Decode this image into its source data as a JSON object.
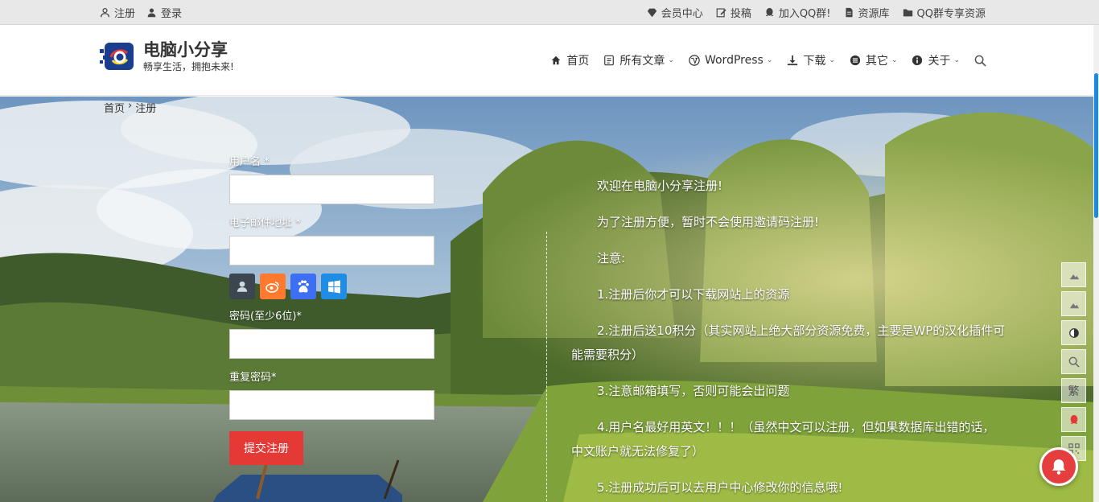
{
  "topbar": {
    "register": "注册",
    "login": "登录",
    "right_links": [
      {
        "label": "会员中心",
        "icon": "diamond-icon"
      },
      {
        "label": "投稿",
        "icon": "edit-icon"
      },
      {
        "label": "加入QQ群!",
        "icon": "qq-icon"
      },
      {
        "label": "资源库",
        "icon": "document-icon"
      },
      {
        "label": "QQ群专享资源",
        "icon": "folder-icon"
      }
    ]
  },
  "header": {
    "brand": "电脑小分享",
    "slogan": "畅享生活，拥抱未来!",
    "nav": [
      {
        "label": "首页",
        "icon": "home-icon",
        "dropdown": false
      },
      {
        "label": "所有文章",
        "icon": "article-icon",
        "dropdown": true
      },
      {
        "label": "WordPress",
        "icon": "wordpress-icon",
        "dropdown": true
      },
      {
        "label": "下载",
        "icon": "download-icon",
        "dropdown": true
      },
      {
        "label": "其它",
        "icon": "list-icon",
        "dropdown": true
      },
      {
        "label": "关于",
        "icon": "info-icon",
        "dropdown": true
      }
    ]
  },
  "breadcrumb": {
    "home": "首页",
    "separator": "›",
    "current": "注册"
  },
  "form": {
    "username_label": "用户名 *",
    "email_label": "电子邮件地址 *",
    "password_label": "密码(至少6位)*",
    "repeat_password_label": "重复密码*",
    "submit_label": "提交注册"
  },
  "notes": {
    "welcome": "欢迎在电脑小分享注册!",
    "line1": "为了注册方便，暂时不会使用邀请码注册!",
    "attention": "注意:",
    "item1": "1.注册后你才可以下载网站上的资源",
    "item2": "2.注册后送10积分（其实网站上绝大部分资源免费，主要是WP的汉化插件可能需要积分）",
    "item3": "3.注意邮箱填写，否则可能会出问题",
    "item4": "4.用户名最好用英文！！！（虽然中文可以注册，但如果数据库出错的话，中文账户就无法修复了）",
    "item5": "5.注册成功后可以去用户中心修改你的信息哦!"
  },
  "side_buttons": {
    "traditional": "繁"
  },
  "colors": {
    "accent": "#e53935",
    "scroll": "#1e88e5"
  }
}
